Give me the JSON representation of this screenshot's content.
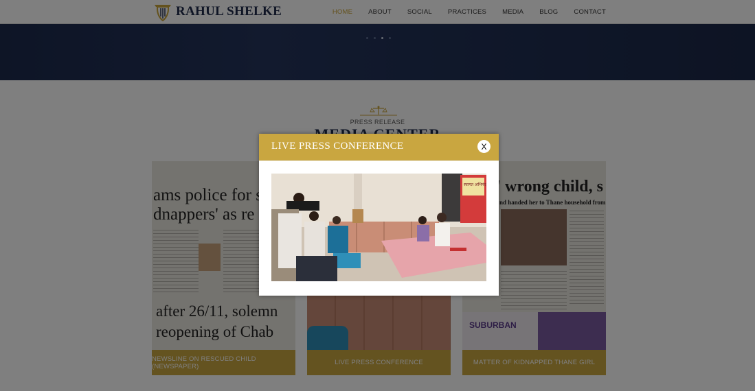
{
  "header": {
    "logo_text": "RAHUL SHELKE",
    "nav": [
      "HOME",
      "ABOUT",
      "SOCIAL",
      "PRACTICES",
      "MEDIA",
      "BLOG",
      "CONTACT"
    ],
    "active_nav": "HOME",
    "accent_color": "#c9a43a"
  },
  "hero": {
    "slides": 4,
    "active_slide": 3
  },
  "section": {
    "pre_title": "PRESS RELEASE",
    "title": "MEDIA CENTER"
  },
  "cards": [
    {
      "caption": "NEWSLINE ON RESCUED CHILD (NEWSPAPER)",
      "headline_top": "ams police for s",
      "headline_top2": "dnappers' as re",
      "headline_bottom": "after 26/11, solemn",
      "headline_bottom2": "reopening of Chab"
    },
    {
      "caption": "LIVE PRESS CONFERENCE"
    },
    {
      "caption": "MATTER OF KIDNAPPED THANE GIRL",
      "headline_top": "uing' wrong child, s",
      "subhead": "nd handed her to Thane household from wh",
      "ad_text": "SUBURBAN"
    }
  ],
  "modal": {
    "title": "LIVE PRESS CONFERENCE",
    "close_label": "X",
    "banner_text": "स्वागत अभिनंद"
  }
}
